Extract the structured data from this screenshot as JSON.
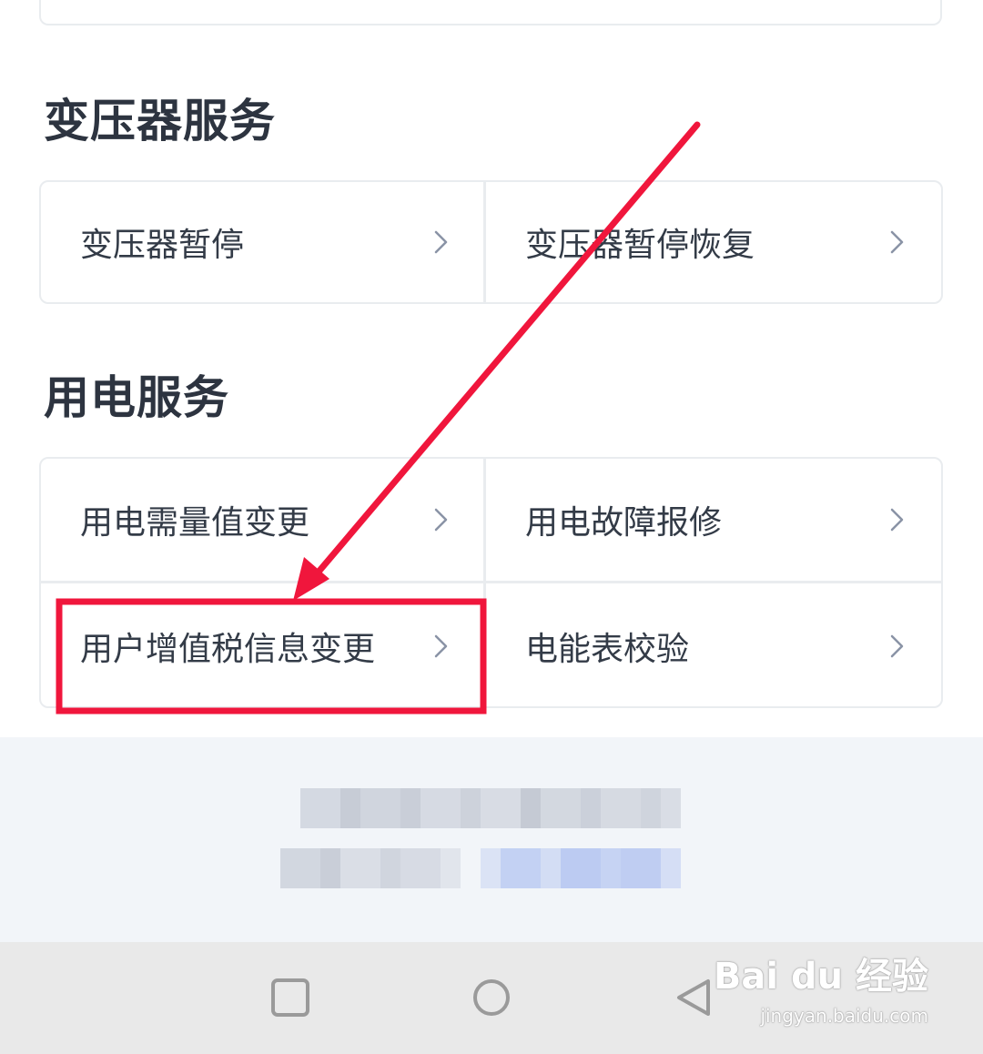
{
  "sections": [
    {
      "title": "变压器服务",
      "items": [
        {
          "label": "变压器暂停"
        },
        {
          "label": "变压器暂停恢复"
        }
      ]
    },
    {
      "title": "用电服务",
      "items": [
        {
          "label": "用电需量值变更"
        },
        {
          "label": "用电故障报修"
        },
        {
          "label": "用户增值税信息变更"
        },
        {
          "label": "电能表校验"
        }
      ]
    }
  ],
  "annotation": {
    "highlight_color": "#f0163c",
    "highlighted_item": "用户增值税信息变更"
  },
  "footer": {
    "note": "pixelated / obscured text"
  },
  "navbar": {
    "buttons": [
      "square-icon",
      "circle-icon",
      "triangle-back-icon"
    ]
  },
  "watermark": {
    "main": "Bai du 经验",
    "sub": "jingyan.baidu.com"
  }
}
